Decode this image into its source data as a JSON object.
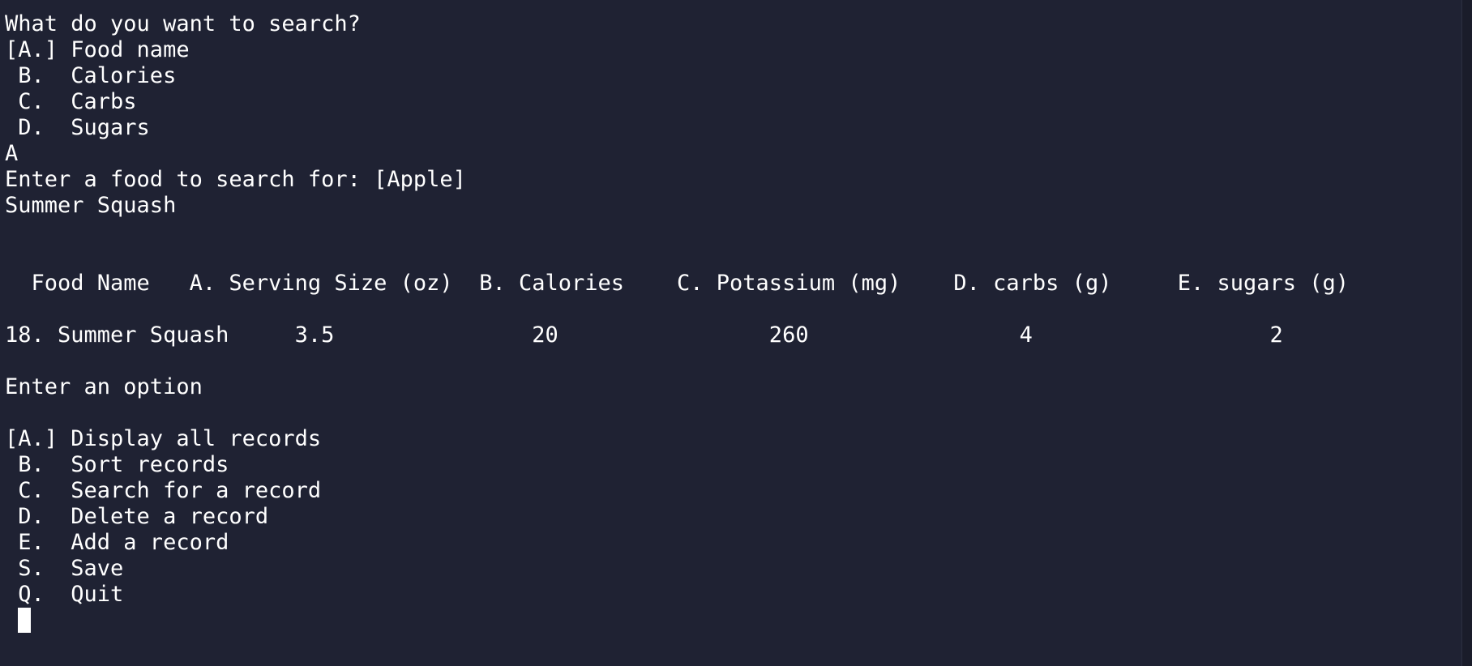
{
  "terminal": {
    "lines": [
      "What do you want to search?",
      "[A.] Food name",
      " B.  Calories",
      " C.  Carbs",
      " D.  Sugars",
      "A",
      "Enter a food to search for: [Apple]",
      "Summer Squash"
    ],
    "table": {
      "header": "  Food Name   A. Serving Size (oz)  B. Calories    C. Potassium (mg)    D. carbs (g)     E. sugars (g)",
      "row": "18. Summer Squash     3.5               20                260                4                  2"
    },
    "prompt": "Enter an option",
    "menu": [
      "[A.] Display all records",
      " B.  Sort records",
      " C.  Search for a record",
      " D.  Delete a record",
      " E.  Add a record",
      " S.  Save",
      " Q.  Quit"
    ]
  },
  "colors": {
    "background": "#1f2233",
    "text": "#ffffff"
  }
}
